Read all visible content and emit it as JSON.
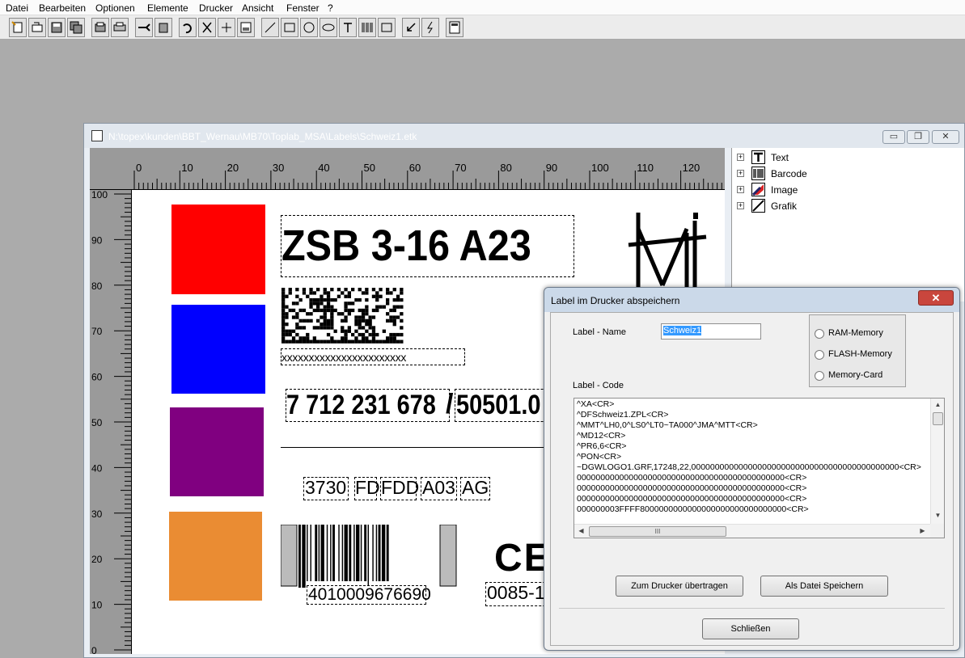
{
  "menu": [
    "Datei",
    "Bearbeiten",
    "Optionen",
    "Elemente",
    "Drucker",
    "Ansicht",
    "Fenster",
    "?"
  ],
  "toolbar": {
    "icons": [
      "new-icon",
      "open-icon",
      "save-icon",
      "save-all-icon",
      "print-preview-icon",
      "print-icon",
      "scissors-icon",
      "paste-icon",
      "undo-icon",
      "cut-icon",
      "align-icon",
      "properties-icon",
      "line-tool-icon",
      "rectangle-tool-icon",
      "circle-tool-icon",
      "ellipse-tool-icon",
      "text-tool-icon",
      "barcode-tool-icon",
      "image-tool-icon",
      "arrow-down-icon",
      "lightning-icon",
      "calculator-icon"
    ]
  },
  "document": {
    "title": "N:\\topex\\kunden\\BBT_Wernau\\MB70\\Toplab_MSA\\Labels\\Schweiz1.etk",
    "window_buttons": {
      "minimize": "▭",
      "restore": "❐",
      "close": "✕"
    }
  },
  "ruler": {
    "h_ticks": [
      "0",
      "10",
      "20",
      "30",
      "40",
      "50",
      "60",
      "70",
      "80",
      "90",
      "100",
      "110",
      "120",
      "1"
    ],
    "v_ticks": [
      "100",
      "90",
      "80",
      "70",
      "60",
      "50",
      "40",
      "30",
      "20",
      "10",
      "0"
    ]
  },
  "label": {
    "colors": [
      "#ff0000",
      "#0000ff",
      "#800080",
      "#ea8c33"
    ],
    "headline": "ZSB 3-16 A23",
    "matrix_text": "xxxxxxxxxxxxxxxxxxxxxxx",
    "part_number": "7 712 231 678",
    "part_number_2": "50501.0",
    "codes": [
      "3730",
      "FD",
      "FDD",
      "A03",
      "AG"
    ],
    "ean": "4010009676690",
    "cert": "0085-1",
    "ce_mark": "CE"
  },
  "tree": {
    "items": [
      {
        "label": "Text",
        "icon": "text-icon"
      },
      {
        "label": "Barcode",
        "icon": "barcode-icon"
      },
      {
        "label": "Image",
        "icon": "image-icon"
      },
      {
        "label": "Grafik",
        "icon": "graphic-icon"
      }
    ]
  },
  "dialog": {
    "title": "Label im Drucker abspeichern",
    "close": "✕",
    "name_label": "Label - Name",
    "name_value": "Schweiz1",
    "code_label": "Label - Code",
    "memory_options": [
      "RAM-Memory",
      "FLASH-Memory",
      "Memory-Card"
    ],
    "code_lines": [
      "^XA<CR>",
      "^DFSchweiz1.ZPL<CR>",
      "^MMT^LH0,0^LS0^LT0~TA000^JMA^MTT<CR>",
      "^MD12<CR>",
      "^PR6,6<CR>",
      "^PON<CR>",
      "~DGWLOGO1.GRF,17248,22,00000000000000000000000000000000000000000000<CR>",
      "00000000000000000000000000000000000000000000<CR>",
      "00000000000000000000000000000000000000000000<CR>",
      "00000000000000000000000000000000000000000000<CR>",
      "000000003FFFF8000000000000000000000000000000<CR>"
    ],
    "hscroll_grip": "III",
    "buttons": {
      "transfer": "Zum Drucker übertragen",
      "save_file": "Als Datei Speichern",
      "close": "Schließen"
    }
  }
}
